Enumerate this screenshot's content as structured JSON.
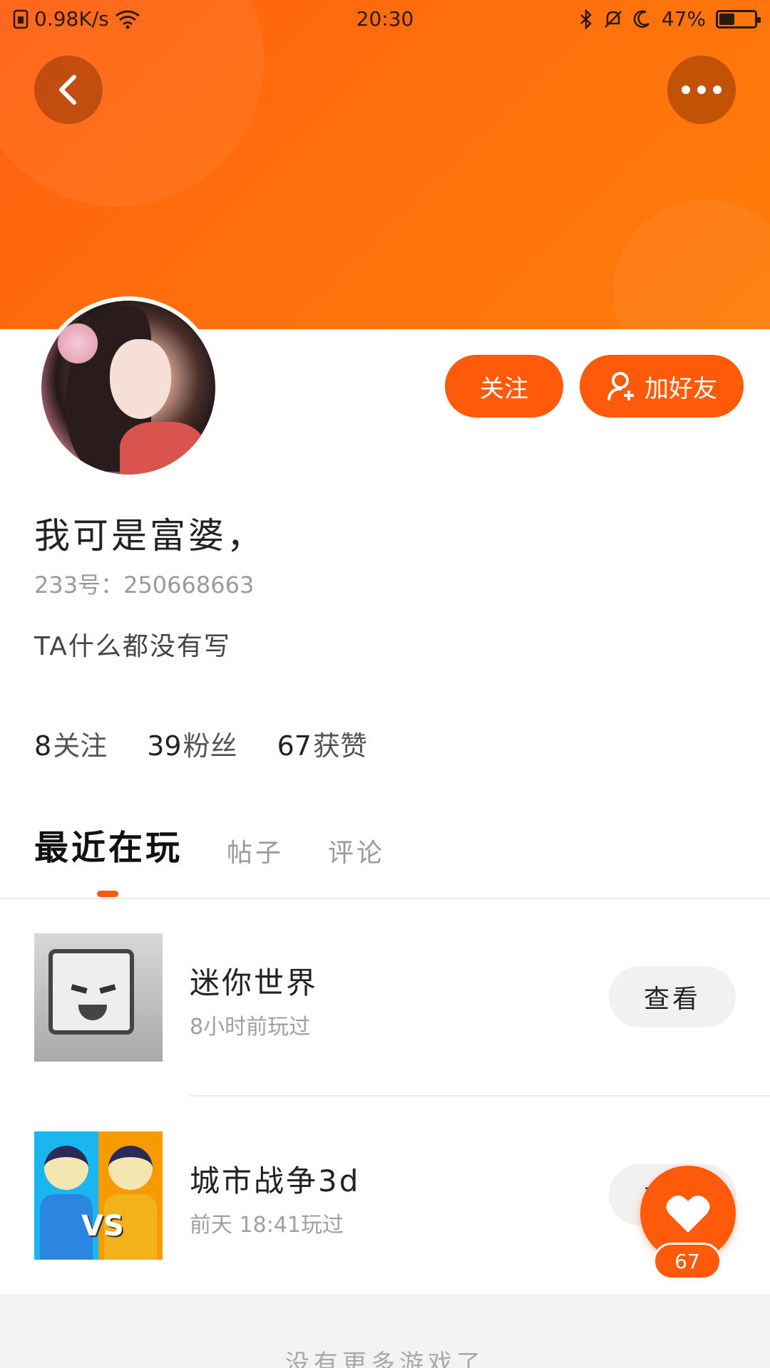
{
  "status_bar": {
    "network_speed": "0.98K/s",
    "time": "20:30",
    "battery": "47%"
  },
  "header": {
    "back_icon": "chevron-left-icon",
    "more_icon": "more-dots-icon",
    "accent_color": "#ff5a0a"
  },
  "profile": {
    "username": "我可是富婆，",
    "user_id": "233号：250668663",
    "bio": "TA什么都没有写",
    "follow_button": "关注",
    "add_friend_button": "加好友"
  },
  "stats": [
    {
      "num": "8",
      "label": "关注"
    },
    {
      "num": "39",
      "label": "粉丝"
    },
    {
      "num": "67",
      "label": "获赞"
    }
  ],
  "tabs": [
    {
      "label": "最近在玩",
      "active": true
    },
    {
      "label": "帖子",
      "active": false
    },
    {
      "label": "评论",
      "active": false
    }
  ],
  "games": [
    {
      "name": "迷你世界",
      "time": "8小时前玩过",
      "button": "查看"
    },
    {
      "name": "城市战争3d",
      "time": "前天 18:41玩过",
      "button": "查看"
    }
  ],
  "like": {
    "count": "67"
  },
  "footer": {
    "text": "没有更多游戏了"
  }
}
